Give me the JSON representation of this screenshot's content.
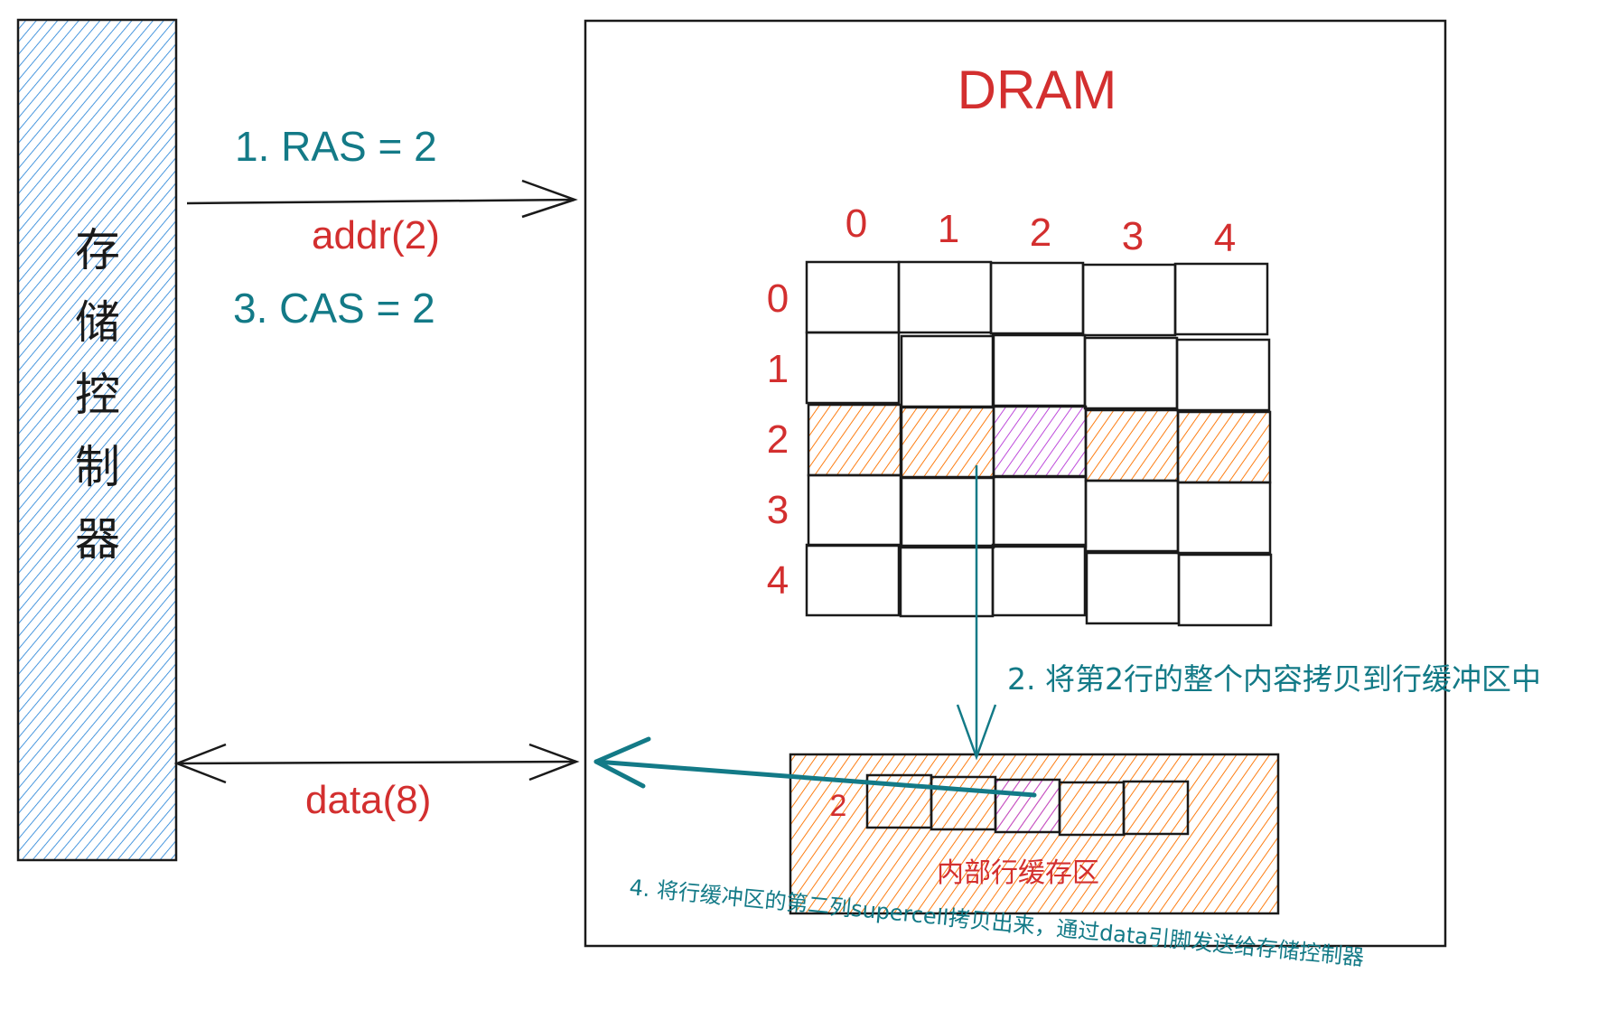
{
  "controller": {
    "label": "存储控制器",
    "chars": [
      "存",
      "储",
      "控",
      "制",
      "器"
    ],
    "fill_color": "#1c7ed6"
  },
  "dram": {
    "title": "DRAM",
    "column_headers": [
      "0",
      "1",
      "2",
      "3",
      "4"
    ],
    "row_headers": [
      "0",
      "1",
      "2",
      "3",
      "4"
    ],
    "selected_row": 2,
    "selected_col": 2,
    "row_highlight_color": "#fd7e14",
    "cell_highlight_color": "#be4bdb"
  },
  "row_buffer": {
    "row_label": "2",
    "label": "内部行缓存区",
    "cell_count": 5,
    "selected_col": 2
  },
  "steps": {
    "step1": "1. RAS = 2",
    "step2": "2. 将第2行的整个内容拷贝到行缓冲区中",
    "step3": "3. CAS = 2",
    "step4": "4. 将行缓冲区的第二列supercell拷贝出来，通过data引脚发送给存储控制器"
  },
  "buses": {
    "addr_label": "addr(2)",
    "data_label": "data(8)"
  },
  "colors": {
    "step_text": "#137a87",
    "label_red": "#d32f2f",
    "stroke": "#1a1a1a"
  }
}
